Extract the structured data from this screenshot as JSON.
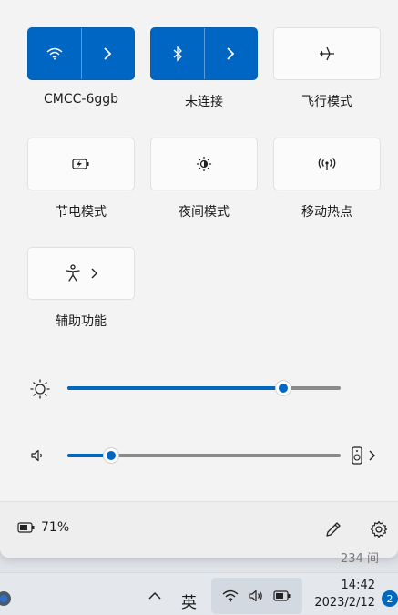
{
  "tiles": [
    {
      "id": "wifi",
      "label": "CMCC-6ggb",
      "active": true,
      "icon": "wifi-icon",
      "has_arrow": true
    },
    {
      "id": "bluetooth",
      "label": "未连接",
      "active": true,
      "icon": "bluetooth-icon",
      "has_arrow": true
    },
    {
      "id": "airplane",
      "label": "飞行模式",
      "active": false,
      "icon": "airplane-icon"
    },
    {
      "id": "battery-saver",
      "label": "节电模式",
      "active": false,
      "icon": "battery-saver-icon"
    },
    {
      "id": "night-light",
      "label": "夜间模式",
      "active": false,
      "icon": "night-light-icon"
    },
    {
      "id": "hotspot",
      "label": "移动热点",
      "active": false,
      "icon": "hotspot-icon"
    },
    {
      "id": "accessibility",
      "label": "辅助功能",
      "active": false,
      "icon": "accessibility-icon",
      "has_arrow": true
    }
  ],
  "brightness": {
    "icon": "brightness-icon",
    "level_percent": 79
  },
  "volume": {
    "icon": "speaker-icon",
    "level_percent": 16,
    "output_icon": "speaker-device-icon"
  },
  "footer": {
    "battery_text": "71%",
    "battery_icon": "battery-icon",
    "edit_icon": "pencil-icon",
    "settings_icon": "gear-icon"
  },
  "behind_text": "234 间",
  "taskbar": {
    "input_method": "英",
    "time": "14:42",
    "date": "2023/2/12",
    "notification_count": "2"
  },
  "colors": {
    "accent": "#0067c0"
  }
}
